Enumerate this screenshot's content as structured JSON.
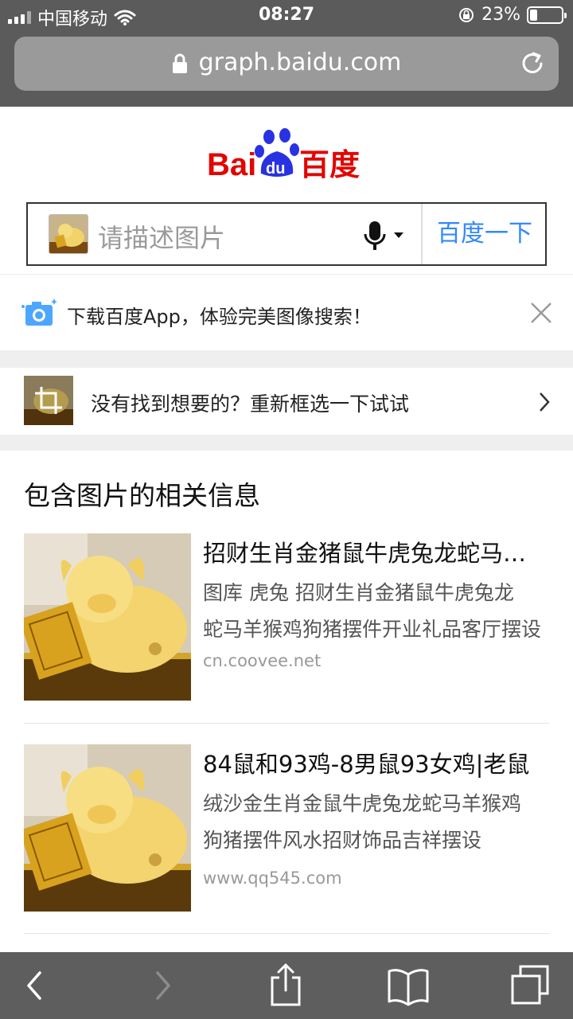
{
  "status_bar": {
    "carrier": "中国移动",
    "time": "08:27",
    "battery": "23%",
    "battery_level": 0.23
  },
  "address_bar": {
    "url": "graph.baidu.com",
    "lock_icon": "lock-icon",
    "reload_icon": "reload-icon"
  },
  "brand": {
    "name": "百度",
    "logo_text_left": "Bai",
    "logo_text_paw": "du",
    "logo_text_right": "百度",
    "primary_color": "#2932e1",
    "red": "#e10601"
  },
  "search": {
    "placeholder": "请描述图片",
    "submit_label": "百度一下",
    "mic_icon": "microphone-icon"
  },
  "app_banner": {
    "text": "下载百度App，体验完美图像搜索！",
    "camera_icon": "camera-icon",
    "close_icon": "close-icon"
  },
  "reselect": {
    "text": "没有找到想要的？重新框选一下试试",
    "crop_icon": "crop-icon",
    "arrow_icon": "chevron-right-icon"
  },
  "related": {
    "heading": "包含图片的相关信息",
    "results": [
      {
        "title": "招财生肖金猪鼠牛虎兔龙蛇马羊猴鸡狗猪摆件",
        "desc_line1": "图库 虎兔 招财生肖金猪鼠牛虎兔龙",
        "desc_line2": "蛇马羊猴鸡狗猪摆件开业礼品客厅摆设",
        "source": "cn.coovee.net"
      },
      {
        "title": "84鼠和93鸡-8男鼠93女鸡|老鼠",
        "desc_line1": "绒沙金生肖金鼠牛虎兔龙蛇马羊猴鸡",
        "desc_line2": "狗猪摆件风水招财饰品吉祥摆设",
        "source": "www.qq545.com"
      }
    ]
  },
  "toolbar": {
    "back_icon": "back-icon",
    "forward_icon": "forward-icon",
    "share_icon": "share-icon",
    "bookmarks_icon": "bookmarks-icon",
    "tabs_icon": "tabs-icon"
  }
}
